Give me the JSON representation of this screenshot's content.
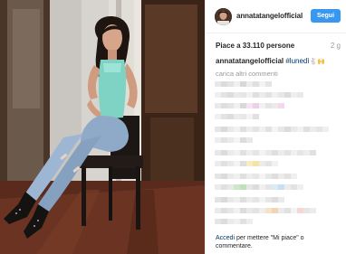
{
  "header": {
    "username": "annatatangelofficial",
    "follow_label": "Segui"
  },
  "stats": {
    "likes_text": "Piace a 33.110 persone",
    "time_ago": "2 g"
  },
  "caption": {
    "username": "annatatangelofficial",
    "hashtag": "#lunedì",
    "emoji": "🐇🙌"
  },
  "comments": {
    "load_more": "carica altri commenti"
  },
  "footer": {
    "login_link": "Accedi",
    "login_text": " per mettere \"Mi piace\" o commentare."
  },
  "colors": {
    "follow_button": "#3897f0",
    "link": "#003569",
    "muted": "#999999",
    "text": "#262626"
  }
}
